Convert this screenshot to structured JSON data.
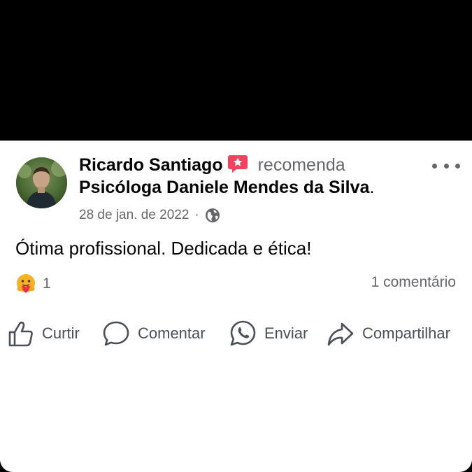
{
  "post": {
    "author": "Ricardo Santiago",
    "action": "recomenda",
    "page": "Psicóloga Daniele Mendes da Silva",
    "page_suffix": ".",
    "date": "28 de jan. de 2022",
    "separator": "·",
    "privacy_icon": "globe-icon",
    "text": "Ótima profissional. Dedicada e ética!"
  },
  "stats": {
    "reaction_icon": "care-reaction-icon",
    "reactions_count": "1",
    "comments_label": "1 comentário"
  },
  "actions": {
    "like": "Curtir",
    "comment": "Comentar",
    "send": "Enviar",
    "share": "Compartilhar"
  },
  "colors": {
    "primary_text": "#050505",
    "secondary_text": "#65676b",
    "recommend_badge": "#f3425f"
  }
}
